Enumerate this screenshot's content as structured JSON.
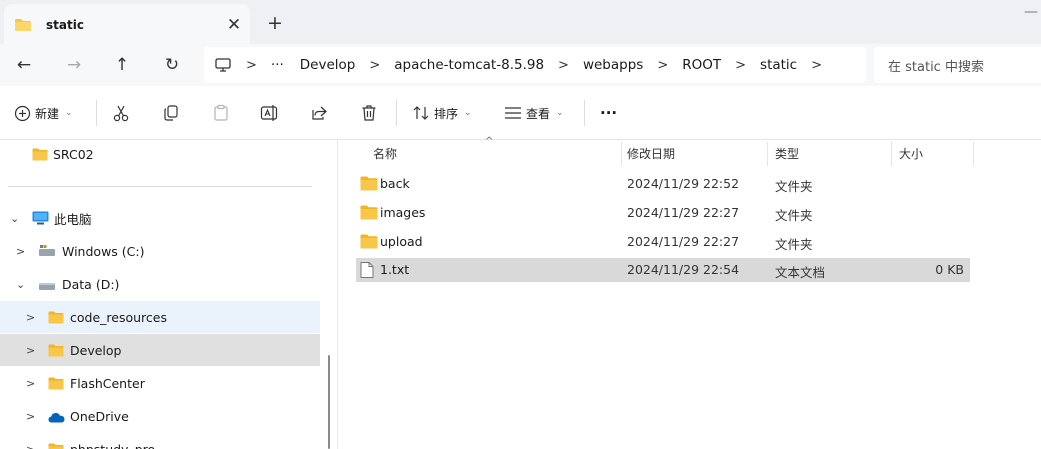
{
  "window": {
    "tab_title": "static",
    "tab_close": "✕",
    "new_tab": "+",
    "minimize": "—"
  },
  "nav": {
    "back": "←",
    "forward": "→",
    "up": "↑",
    "refresh": "↻",
    "more": "···"
  },
  "breadcrumb": [
    "Develop",
    "apache-tomcat-8.5.98",
    "webapps",
    "ROOT",
    "static"
  ],
  "breadcrumb_separator": ">",
  "search": {
    "placeholder": "在 static 中搜索"
  },
  "toolbar": {
    "new_label": "新建",
    "sort_label": "排序",
    "view_label": "查看",
    "more": "···",
    "caret": "⌄"
  },
  "sidebar": {
    "pinned": [
      {
        "label": "SRC02",
        "icon": "folder-icon"
      }
    ],
    "this_pc": {
      "label": "此电脑",
      "icon": "computer-icon",
      "chevron": "⌄"
    },
    "drives": [
      {
        "label": "Windows (C:)",
        "icon": "drive-icon",
        "chevron": ">"
      },
      {
        "label": "Data (D:)",
        "icon": "drive-icon",
        "chevron": "⌄"
      }
    ],
    "folders": [
      {
        "label": "code_resources",
        "icon": "folder-icon",
        "chevron": ">",
        "state": "hover"
      },
      {
        "label": "Develop",
        "icon": "folder-icon",
        "chevron": ">",
        "state": "selected"
      },
      {
        "label": "FlashCenter",
        "icon": "folder-icon",
        "chevron": ">"
      },
      {
        "label": "OneDrive",
        "icon": "cloud-icon",
        "chevron": ">"
      },
      {
        "label": "phpstudy_pro",
        "icon": "folder-icon",
        "chevron": ">"
      }
    ]
  },
  "columns": {
    "name": "名称",
    "modified": "修改日期",
    "type": "类型",
    "size": "大小",
    "sort_indicator": "^"
  },
  "files": [
    {
      "name": "back",
      "modified": "2024/11/29 22:52",
      "type": "文件夹",
      "size": "",
      "icon": "folder-icon"
    },
    {
      "name": "images",
      "modified": "2024/11/29 22:27",
      "type": "文件夹",
      "size": "",
      "icon": "folder-icon"
    },
    {
      "name": "upload",
      "modified": "2024/11/29 22:27",
      "type": "文件夹",
      "size": "",
      "icon": "folder-icon"
    },
    {
      "name": "1.txt",
      "modified": "2024/11/29 22:54",
      "type": "文本文档",
      "size": "0 KB",
      "icon": "text-file-icon"
    }
  ],
  "colors": {
    "folder": "#f8c74a",
    "accent": "#0067c0",
    "selected_row": "#d9d9d9",
    "hover_row": "#eaf3fc"
  }
}
